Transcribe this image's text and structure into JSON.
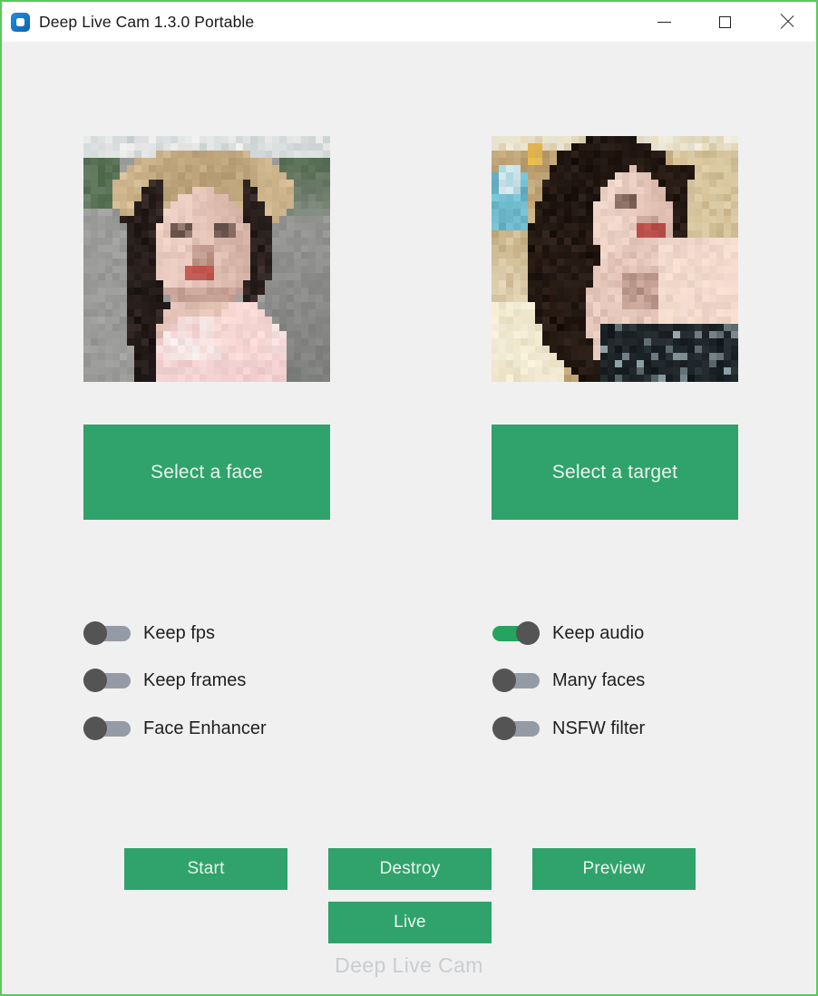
{
  "window": {
    "title": "Deep Live Cam 1.3.0 Portable",
    "app_icon": "deep-live-cam-logo-icon",
    "border_color": "#5cc85c",
    "titlebar_bg": "#ffffff",
    "body_bg": "#f0f0f0",
    "controls": {
      "minimize": "minimize-icon",
      "maximize": "maximize-icon",
      "close": "close-icon"
    }
  },
  "previews": {
    "face": {
      "label": "source-face-preview",
      "description": "Pixelated photo of a woman wearing a straw hat outdoors"
    },
    "target": {
      "label": "target-preview",
      "description": "Pixelated photo of a woman indoors with dark hair"
    }
  },
  "select_buttons": {
    "face": "Select a face",
    "target": "Select a target"
  },
  "switches": {
    "accent_on_color": "#26a45f",
    "track_off_color": "#949ba5",
    "knob_color": "#545454",
    "items": [
      {
        "label": "Keep fps",
        "on": false,
        "column": "left"
      },
      {
        "label": "Keep frames",
        "on": false,
        "column": "left"
      },
      {
        "label": "Face Enhancer",
        "on": false,
        "column": "left"
      },
      {
        "label": "Keep audio",
        "on": true,
        "column": "right"
      },
      {
        "label": "Many faces",
        "on": false,
        "column": "right"
      },
      {
        "label": "NSFW filter",
        "on": false,
        "column": "right"
      }
    ]
  },
  "actions": {
    "button_color": "#2fa36b",
    "start": "Start",
    "destroy": "Destroy",
    "preview": "Preview",
    "live": "Live"
  },
  "footer": {
    "text": "Deep Live Cam",
    "color": "#c9cdd2"
  }
}
